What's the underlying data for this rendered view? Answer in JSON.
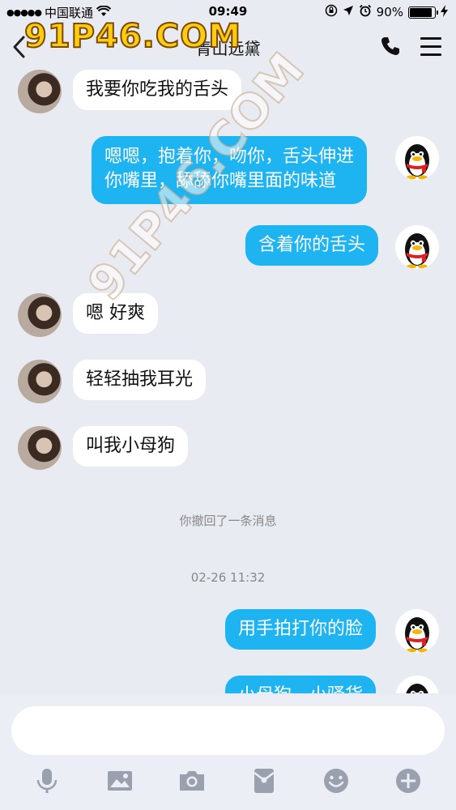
{
  "status_bar": {
    "signal_dots": "●●●●●",
    "carrier": "中国联通",
    "wifi_icon": "wifi-icon",
    "time": "09:49",
    "battery_percent": "90%",
    "battery_level": 0.9
  },
  "nav": {
    "back_icon": "chevron-left-icon",
    "title": "青山远黛",
    "phone_icon": "phone-icon",
    "menu_icon": "menu-icon"
  },
  "watermark": {
    "top": "91P46.COM",
    "diagonal": "91P46.COM"
  },
  "messages": [
    {
      "side": "in",
      "text": "我要你吃我的舌头"
    },
    {
      "side": "out",
      "lines": [
        "嗯嗯，抱着你，吻你，舌头伸进",
        "你嘴里，舔舔你嘴里面的味道"
      ]
    },
    {
      "side": "out",
      "text": "含着你的舌头"
    },
    {
      "side": "in",
      "text": "嗯 好爽"
    },
    {
      "side": "in",
      "text": "轻轻抽我耳光"
    },
    {
      "side": "in",
      "text": "叫我小母狗"
    },
    {
      "side": "out",
      "text": "用手拍打你的脸"
    },
    {
      "side": "out",
      "text": "小母狗，小骚货"
    }
  ],
  "notices": {
    "recall": "你撤回了一条消息",
    "timestamp": "02-26 11:32"
  },
  "input": {
    "placeholder": ""
  },
  "toolbar": {
    "icons": [
      "microphone-icon",
      "image-icon",
      "camera-icon",
      "red-packet-icon",
      "emoji-icon",
      "plus-icon"
    ]
  },
  "colors": {
    "background": "#e9ebf3",
    "outgoing_bubble": "#1eb4f2",
    "incoming_bubble": "#ffffff",
    "toolbar_icon": "#9aa0ad"
  }
}
